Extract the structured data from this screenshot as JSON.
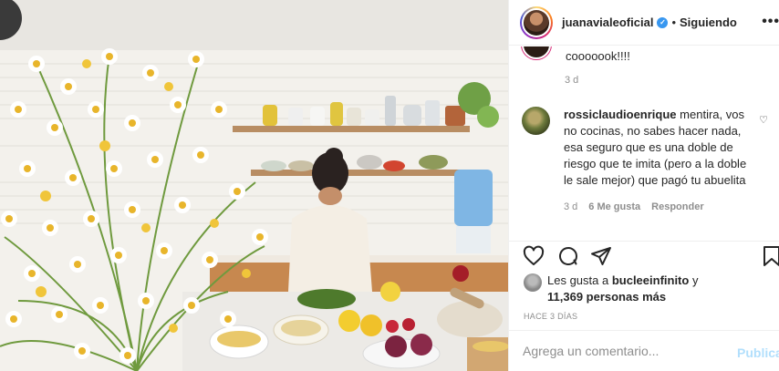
{
  "post": {
    "username": "juanavialeoficial",
    "verified_icon": "verified-badge-icon",
    "separator": "•",
    "follow_status": "Siguiendo",
    "more_icon": "more-options-icon",
    "more_text": "•••"
  },
  "comments": {
    "previous": {
      "text": "cooooook!!!!",
      "time": "3 d"
    },
    "items": [
      {
        "username": "rossiclaudioenrique",
        "text": "mentira, vos no cocinas, no sabes hacer nada, esa seguro que es una doble de riesgo que te imita (pero a la doble le sale mejor) que pagó tu abuelita",
        "time": "3 d",
        "likes": "6 Me gusta",
        "reply": "Responder",
        "heart_icon": "heart-outline-icon",
        "heart_glyph": "♡"
      }
    ]
  },
  "actions": {
    "like_icon": "heart-icon",
    "comment_icon": "comment-icon",
    "share_icon": "send-icon",
    "save_icon": "bookmark-icon"
  },
  "likes": {
    "prefix": "Les gusta a ",
    "user": "bucleeinfinito",
    "conjunction": " y",
    "count": "11,369 personas más"
  },
  "timestamp": "HACE 3 DÍAS",
  "composer": {
    "placeholder": "Agrega un comentario...",
    "publish_label": "Publicar"
  },
  "colors": {
    "accent_blue": "#3897f0",
    "publish_disabled": "#b2dffc",
    "secondary_text": "#8e8e8e",
    "primary_text": "#262626"
  }
}
